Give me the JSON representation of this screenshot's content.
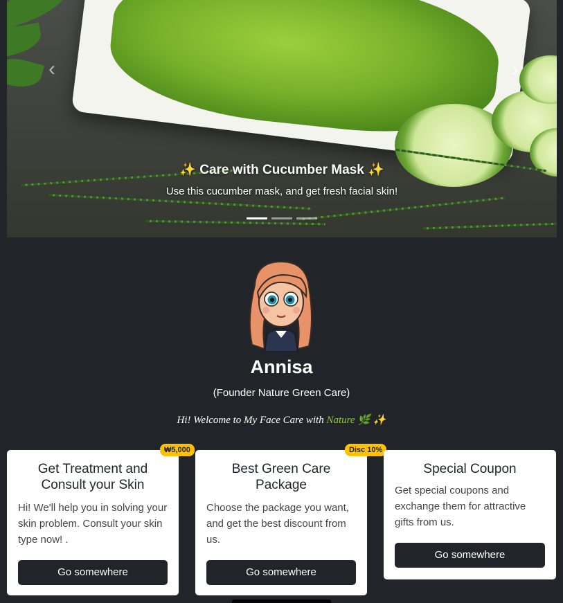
{
  "carousel": {
    "caption_title": "✨ Care with Cucumber Mask ✨",
    "caption_text": "Use this cucumber mask, and get fresh facial skin!",
    "prev_icon": "chevron-left-icon",
    "next_icon": "chevron-right-icon",
    "slides_count": 3,
    "active_slide": 1
  },
  "profile": {
    "name": "Annisa",
    "role": "(Founder Nature Green Care)",
    "welcome_prefix": "Hi! Welcome to My Face Care with ",
    "welcome_highlight": "Nature",
    "welcome_suffix": " 🌿 ✨",
    "highlight_color": "#8fc74a"
  },
  "cards": [
    {
      "badge": "₩5,000",
      "title": "Get Treatment and Consult your Skin",
      "text": "Hi! We'll help you in solving your skin problem. Consult your skin type now! .",
      "button": "Go somewhere"
    },
    {
      "badge": "Disc 10%",
      "title": "Best Green Care Package",
      "text": "Choose the package you want, and get the best discount from us.",
      "button": "Go somewhere"
    },
    {
      "badge": "",
      "title": "Special Coupon",
      "text": "Get special coupons and exchange them for attractive gifts from us.",
      "button": "Go somewhere"
    }
  ],
  "colors": {
    "page_bg": "#212529",
    "badge_bg": "#ffc107",
    "button_bg": "#212529"
  }
}
